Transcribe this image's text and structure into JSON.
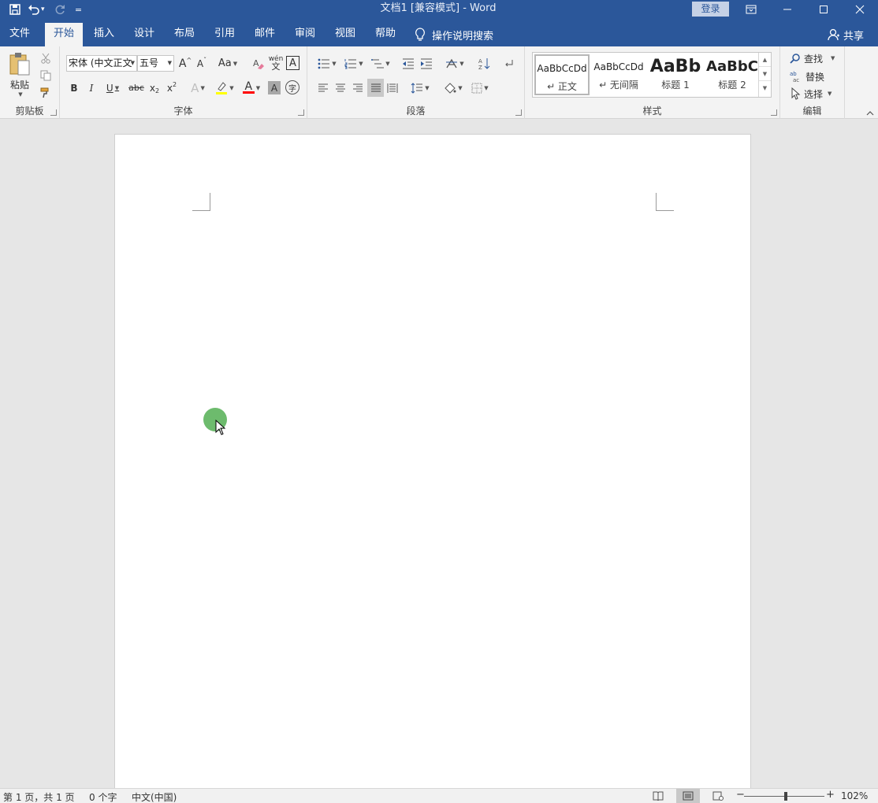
{
  "titlebar": {
    "title": "文档1 [兼容模式] - Word",
    "login": "登录",
    "qat_more": "="
  },
  "tabs": [
    {
      "label": "文件",
      "active": false
    },
    {
      "label": "开始",
      "active": true
    },
    {
      "label": "插入",
      "active": false
    },
    {
      "label": "设计",
      "active": false
    },
    {
      "label": "布局",
      "active": false
    },
    {
      "label": "引用",
      "active": false
    },
    {
      "label": "邮件",
      "active": false
    },
    {
      "label": "审阅",
      "active": false
    },
    {
      "label": "视图",
      "active": false
    },
    {
      "label": "帮助",
      "active": false
    }
  ],
  "tellme": "操作说明搜索",
  "share": "共享",
  "ribbon": {
    "clipboard": {
      "label": "剪贴板",
      "paste": "粘贴"
    },
    "font": {
      "label": "字体",
      "font_name": "宋体 (中文正文",
      "font_size": "五号",
      "grow": "A",
      "shrink": "A",
      "change_case": "Aa",
      "phonetic_top": "wén",
      "phonetic_bottom": "文",
      "char_border": "A",
      "bold": "B",
      "italic": "I",
      "underline": "U",
      "strike": "abc",
      "subscript": "x",
      "superscript": "x",
      "text_effect": "A",
      "font_color": "A",
      "char_shading": "A",
      "enclose": "字"
    },
    "paragraph": {
      "label": "段落"
    },
    "styles": {
      "label": "样式",
      "items": [
        {
          "preview": "AaBbCcDd",
          "name": "↵ 正文",
          "selected": true
        },
        {
          "preview": "AaBbCcDd",
          "name": "↵ 无间隔",
          "selected": false
        },
        {
          "preview": "AaBb",
          "name": "标题 1",
          "selected": false
        },
        {
          "preview": "AaBbC",
          "name": "标题 2",
          "selected": false
        }
      ]
    },
    "editing": {
      "label": "编辑",
      "find": "查找",
      "replace": "替换",
      "select": "选择"
    }
  },
  "status": {
    "page": "第 1 页，共 1 页",
    "words": "0 个字",
    "language": "中文(中国)",
    "zoom": "102%",
    "zoom_minus": "−",
    "zoom_plus": "+"
  },
  "colors": {
    "brand": "#2b579a",
    "highlight": "#ffff00",
    "font_color": "#ff0000",
    "click_marker": "#6dbb6d"
  }
}
